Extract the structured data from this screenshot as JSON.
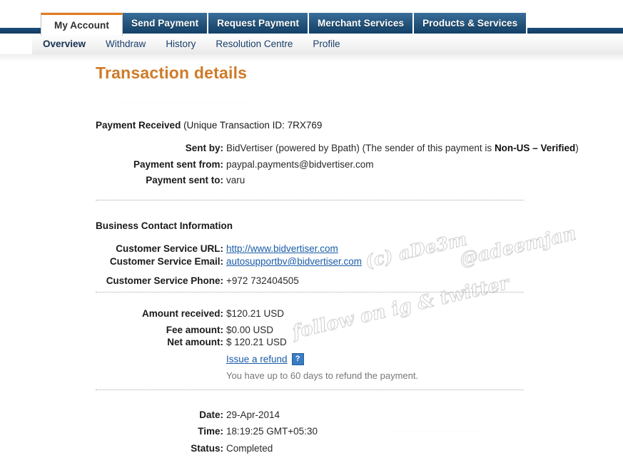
{
  "tabs": [
    {
      "label": "My Account",
      "active": true
    },
    {
      "label": "Send Payment",
      "active": false
    },
    {
      "label": "Request Payment",
      "active": false
    },
    {
      "label": "Merchant Services",
      "active": false
    },
    {
      "label": "Products & Services",
      "active": false
    }
  ],
  "subnav": [
    {
      "label": "Overview",
      "active": true
    },
    {
      "label": "Withdraw",
      "active": false
    },
    {
      "label": "History",
      "active": false
    },
    {
      "label": "Resolution Centre",
      "active": false
    },
    {
      "label": "Profile",
      "active": false
    }
  ],
  "page": {
    "title": "Transaction details",
    "redacted_top": "—————————————",
    "redacted_bottom": "——————————"
  },
  "payment": {
    "heading_bold": "Payment Received",
    "heading_rest": " (Unique Transaction ID: 7RX769",
    "transaction_id": "7RX769",
    "rows": [
      {
        "label": "Sent by:",
        "value_prefix": "BidVertiser (powered by Bpath) (The sender of this payment is ",
        "value_bold": "Non-US – Verified",
        "value_suffix": ")"
      },
      {
        "label": "Payment sent from:",
        "value": "paypal.payments@bidvertiser.com"
      },
      {
        "label": "Payment sent to:",
        "value": "varu"
      }
    ]
  },
  "business": {
    "heading": "Business Contact Information",
    "rows": [
      {
        "label": "Customer Service URL:",
        "value": "http://www.bidvertiser.com",
        "link": true
      },
      {
        "label": "Customer Service Email:",
        "value": "autosupportbv@bidvertiser.com",
        "link": true
      },
      {
        "label": "Customer Service Phone:",
        "value": "+972 732404505",
        "link": false
      }
    ]
  },
  "amounts": {
    "rows": [
      {
        "label": "Amount received:",
        "value": "$120.21 USD"
      },
      {
        "label": "Fee amount:",
        "value": "$0.00 USD"
      },
      {
        "label": "Net amount:",
        "value": "$ 120.21 USD"
      }
    ],
    "refund_link": "Issue a refund",
    "help_icon_glyph": "?",
    "refund_note": "You have up to 60 days to refund the payment."
  },
  "meta": {
    "rows": [
      {
        "label": "Date:",
        "value": "29-Apr-2014"
      },
      {
        "label": "Time:",
        "value": "18:19:25 GMT+05:30"
      },
      {
        "label": "Status:",
        "value": "Completed"
      }
    ]
  },
  "watermark": {
    "copyright": "(c) aDe3m",
    "handle": "@adeemjan",
    "follow": "follow on ig & twitter"
  },
  "colors": {
    "accent_orange": "#cf7b28",
    "tab_blue": "#27587f",
    "link_blue": "#1a5ca8"
  }
}
